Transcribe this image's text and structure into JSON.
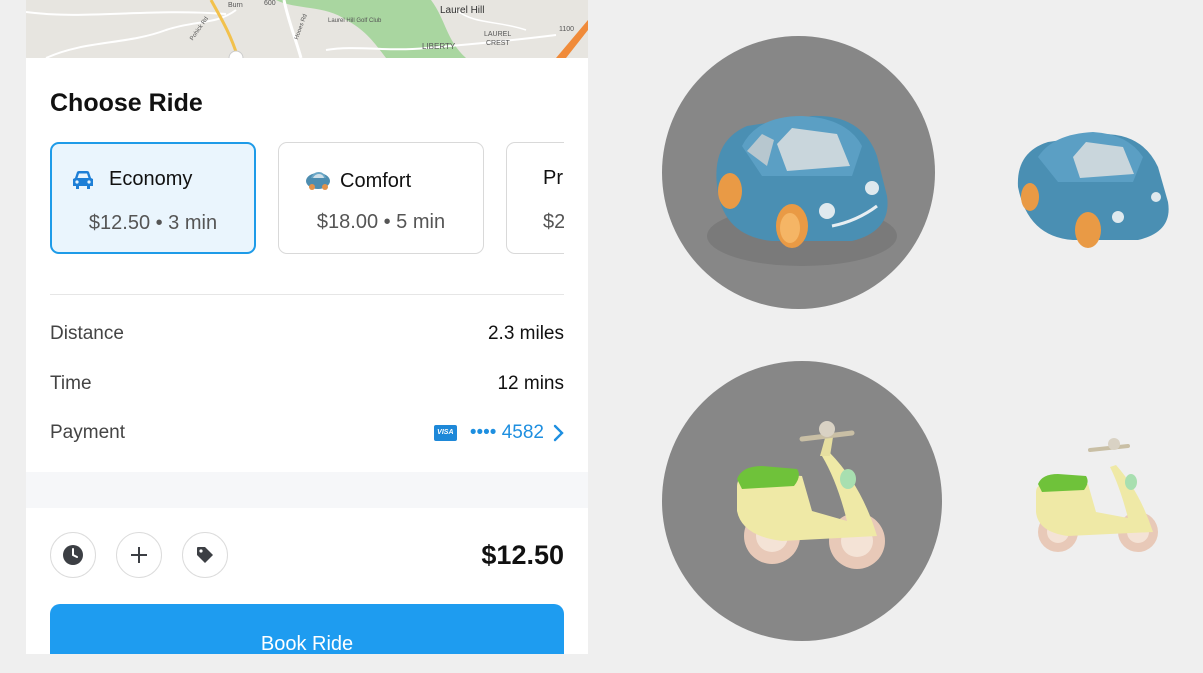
{
  "map": {
    "labels": [
      "Laurel Hill",
      "Laurel Hill Golf Club",
      "LIBERTY",
      "LAUREL",
      "CREST",
      "Burn",
      "600",
      "1100",
      "Hooes Rd",
      "Pohick Rd"
    ]
  },
  "ride": {
    "title": "Choose Ride",
    "options": [
      {
        "name": "Economy",
        "detail": "$12.50 • 3 min",
        "icon": "car-icon",
        "selected": true
      },
      {
        "name": "Comfort",
        "detail": "$18.00 • 5 min",
        "icon": "comfort-car-icon",
        "selected": false
      },
      {
        "name": "Pr",
        "detail": "$2",
        "icon": "",
        "selected": false
      }
    ],
    "details": {
      "distance_label": "Distance",
      "distance_value": "2.3 miles",
      "time_label": "Time",
      "time_value": "12 mins",
      "payment_label": "Payment",
      "payment_card": "•••• 4582",
      "payment_brand": "VISA"
    },
    "actions": [
      "clock-icon",
      "plus-icon",
      "tag-icon"
    ],
    "total": "$12.50",
    "book_label": "Book Ride"
  },
  "colors": {
    "accent": "#1e9cf0",
    "selected_bg": "#eaf5fd",
    "car_blue": "#4a8fb3",
    "scooter_yellow": "#efe9a6",
    "scooter_green": "#6fc23a"
  }
}
